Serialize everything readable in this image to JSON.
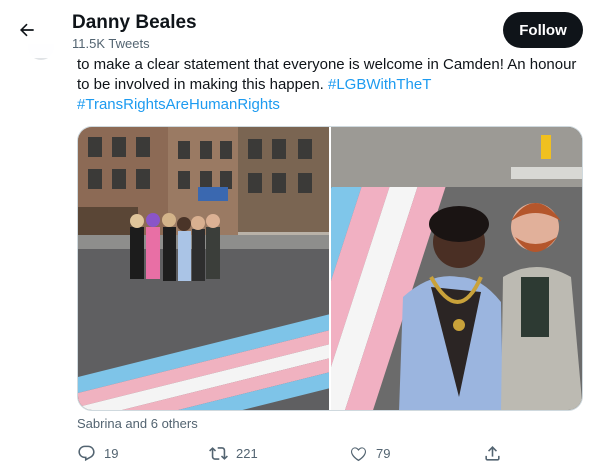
{
  "header": {
    "name": "Danny Beales",
    "tweet_count": "11.5K Tweets",
    "follow_label": "Follow",
    "back_icon": "arrow-left-icon"
  },
  "tweet": {
    "text_line1": "to make a clear statement that everyone is welcome in Camden! An honour",
    "text_line2_prefix": "to be involved in making this happen.",
    "hashtags": [
      "#LGBWithTheT",
      "#TransRightsAreHumanRights"
    ]
  },
  "media": {
    "photos": [
      {
        "description_icon": "photo-icon"
      },
      {
        "description_icon": "photo-icon"
      }
    ]
  },
  "liked_by": "Sabrina and 6 others",
  "actions": {
    "reply_count": "19",
    "retweet_count": "221",
    "like_count": "79"
  },
  "colors": {
    "accent": "#1d9bf0",
    "text": "#0f1419",
    "secondary": "#536471",
    "follow_bg": "#0f1419"
  }
}
